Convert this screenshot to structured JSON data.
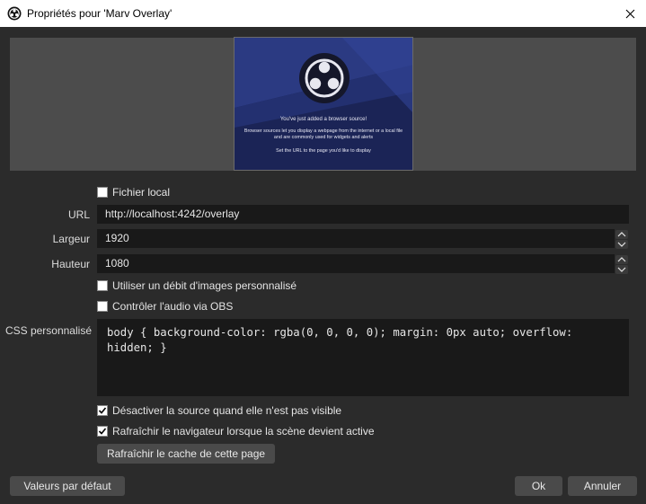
{
  "window": {
    "title": "Propriétés pour 'Marv Overlay'"
  },
  "preview": {
    "line1": "You've just added a browser source!",
    "line2": "Browser sources let you display a webpage from the internet or a local file and are commonly used for widgets and alerts",
    "line3": "Set the URL to the page you'd like to display"
  },
  "form": {
    "local_file": {
      "label": "Fichier local",
      "checked": false
    },
    "url": {
      "label": "URL",
      "value": "http://localhost:4242/overlay"
    },
    "width": {
      "label": "Largeur",
      "value": "1920"
    },
    "height": {
      "label": "Hauteur",
      "value": "1080"
    },
    "custom_fps": {
      "label": "Utiliser un débit d'images personnalisé",
      "checked": false
    },
    "audio_via_obs": {
      "label": "Contrôler l'audio via OBS",
      "checked": false
    },
    "custom_css": {
      "label": "CSS personnalisé",
      "value": "body { background-color: rgba(0, 0, 0, 0); margin: 0px auto; overflow: hidden; }"
    },
    "shutdown_when_hidden": {
      "label": "Désactiver la source quand elle n'est pas visible",
      "checked": true
    },
    "refresh_on_active": {
      "label": "Rafraîchir le navigateur lorsque la scène devient active",
      "checked": true
    },
    "refresh_cache_button": "Rafraîchir le cache de cette page"
  },
  "footer": {
    "defaults_button": "Valeurs par défaut",
    "ok_button": "Ok",
    "cancel_button": "Annuler"
  }
}
